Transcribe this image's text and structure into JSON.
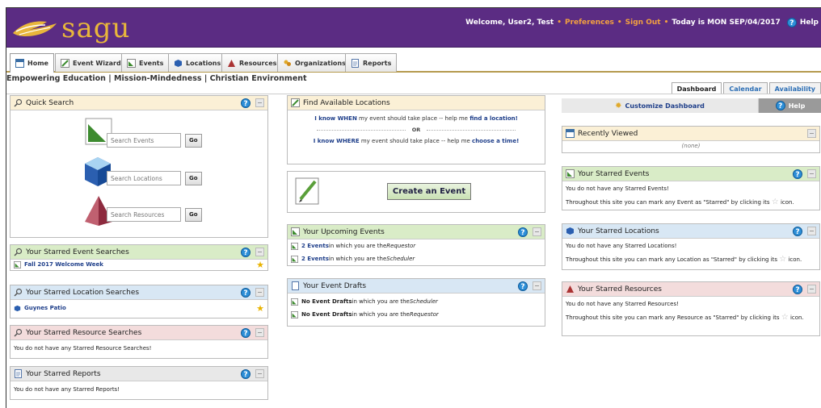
{
  "header": {
    "logo_text": "sagu",
    "welcome": "Welcome, User2, Test",
    "preferences": "Preferences",
    "sign_out": "Sign Out",
    "today_label": "Today is",
    "today_value": "MON SEP/04/2017",
    "help": "Help"
  },
  "tabs": [
    {
      "label": "Home",
      "icon": "home-icon"
    },
    {
      "label": "Event Wizard",
      "icon": "wizard-icon"
    },
    {
      "label": "Events",
      "icon": "events-icon"
    },
    {
      "label": "Locations",
      "icon": "locations-icon"
    },
    {
      "label": "Resources",
      "icon": "resources-icon"
    },
    {
      "label": "Organizations",
      "icon": "organizations-icon"
    },
    {
      "label": "Reports",
      "icon": "reports-icon"
    }
  ],
  "mission": "Empowering Education | Mission-Mindedness | Christian Environment",
  "view_tabs": [
    "Dashboard",
    "Calendar",
    "Availability"
  ],
  "quick_search": {
    "title": "Quick Search",
    "events_placeholder": "Search Events",
    "locations_placeholder": "Search Locations",
    "resources_placeholder": "Search Resources",
    "go": "Go"
  },
  "starred_event_searches": {
    "title": "Your Starred Event Searches",
    "items": [
      "Fall 2017 Welcome Week"
    ]
  },
  "starred_location_searches": {
    "title": "Your Starred Location Searches",
    "items": [
      "Guynes Patio"
    ]
  },
  "starred_resource_searches": {
    "title": "Your Starred Resource Searches",
    "message": "You do not have any Starred Resource Searches!"
  },
  "starred_reports": {
    "title": "Your Starred Reports",
    "message": "You do not have any Starred Reports!"
  },
  "find_locations": {
    "title": "Find Available Locations",
    "line1_a": "I know WHEN",
    "line1_b": " my event should take place -- help me ",
    "line1_c": "find a location!",
    "or": "OR",
    "line2_a": "I know WHERE",
    "line2_b": " my event should take place -- help me ",
    "line2_c": "choose a time!"
  },
  "create_event": {
    "label": "Create an Event"
  },
  "upcoming_events": {
    "title": "Your Upcoming Events",
    "rows": [
      {
        "count": "2 Events",
        "text": " in which you are the ",
        "role": "Requestor"
      },
      {
        "count": "2 Events",
        "text": " in which you are the ",
        "role": "Scheduler"
      }
    ]
  },
  "event_drafts": {
    "title": "Your Event Drafts",
    "rows": [
      {
        "count": "No Event Drafts",
        "text": " in which you are the ",
        "role": "Scheduler"
      },
      {
        "count": "No Event Drafts",
        "text": " in which you are the ",
        "role": "Requestor"
      }
    ]
  },
  "right": {
    "customize": "Customize Dashboard",
    "help": "Help",
    "recently_viewed_title": "Recently Viewed",
    "recently_viewed_none": "(none)",
    "starred_events_title": "Your Starred Events",
    "starred_events_msg1": "You do not have any Starred Events!",
    "starred_events_msg2": "Throughout this site you can mark any Event as \"Starred\" by clicking its",
    "starred_events_msg3": "icon.",
    "starred_locations_title": "Your Starred Locations",
    "starred_locations_msg1": "You do not have any Starred Locations!",
    "starred_locations_msg2": "Throughout this site you can mark any Location as \"Starred\" by clicking its",
    "starred_locations_msg3": "icon.",
    "starred_resources_title": "Your Starred Resources",
    "starred_resources_msg1": "You do not have any Starred Resources!",
    "starred_resources_msg2": "Throughout this site you can mark any Resource as \"Starred\" by clicking its",
    "starred_resources_msg3": "icon."
  }
}
